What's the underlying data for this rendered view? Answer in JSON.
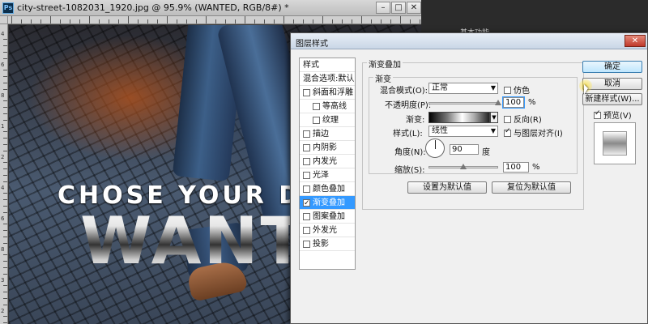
{
  "document": {
    "title": "city-street-1082031_1920.jpg @ 95.9% (WANTED, RGB/8#) *",
    "app_icon": "Ps",
    "minimize_icon": "minimize-icon",
    "maximize_icon": "maximize-icon",
    "close_icon": "close-icon",
    "minimize_glyph": "–",
    "maximize_glyph": "□",
    "close_glyph": "✕",
    "ruler_left_numbers": [
      "4",
      "6",
      "8",
      "1",
      "2",
      "4",
      "6",
      "8",
      "3",
      "2"
    ],
    "canvas": {
      "headline": "CHOSE YOUR DE",
      "big_word": "WANT"
    }
  },
  "workspace_button": "基本功能",
  "dialog": {
    "title": "图层样式",
    "close_glyph": "✕",
    "styles": [
      {
        "label": "样式",
        "type": "header"
      },
      {
        "label": "混合选项:默认",
        "type": "header"
      },
      {
        "label": "斜面和浮雕",
        "checked": false,
        "type": "sub"
      },
      {
        "label": "等高线",
        "checked": false,
        "type": "indent2"
      },
      {
        "label": "纹理",
        "checked": false,
        "type": "indent2"
      },
      {
        "label": "描边",
        "checked": false,
        "type": "sub"
      },
      {
        "label": "内阴影",
        "checked": false,
        "type": "sub"
      },
      {
        "label": "内发光",
        "checked": false,
        "type": "sub"
      },
      {
        "label": "光泽",
        "checked": false,
        "type": "sub"
      },
      {
        "label": "颜色叠加",
        "checked": false,
        "type": "sub"
      },
      {
        "label": "渐变叠加",
        "checked": true,
        "selected": true,
        "type": "sub"
      },
      {
        "label": "图案叠加",
        "checked": false,
        "type": "sub"
      },
      {
        "label": "外发光",
        "checked": false,
        "type": "sub"
      },
      {
        "label": "投影",
        "checked": false,
        "type": "sub"
      }
    ],
    "section_title": "渐变叠加",
    "group_title": "渐变",
    "blend_mode_label": "混合模式(O):",
    "blend_mode_value": "正常",
    "dither_label": "仿色",
    "opacity_label": "不透明度(P):",
    "opacity_value": "100",
    "opacity_unit": "%",
    "opacity_level": 1.0,
    "gradient_label": "渐变:",
    "reverse_label": "反向(R)",
    "style_label": "样式(L):",
    "style_value": "线性",
    "align_label": "与图层对齐(I)",
    "align_checked": true,
    "angle_label": "角度(N):",
    "angle_value": "90",
    "angle_unit": "度",
    "scale_label": "缩放(S):",
    "scale_value": "100",
    "scale_unit": "%",
    "scale_level": 0.5,
    "make_default_label": "设置为默认值",
    "reset_default_label": "复位为默认值",
    "ok_label": "确定",
    "cancel_label": "取消",
    "new_style_label": "新建样式(W)...",
    "preview_label": "预览(V)",
    "preview_checked": true
  }
}
